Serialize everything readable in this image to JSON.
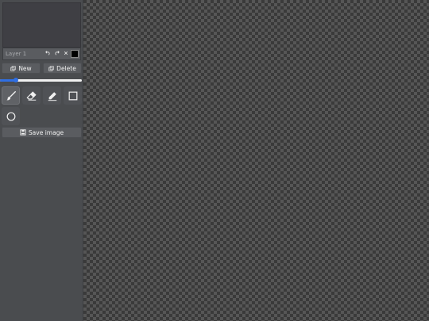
{
  "layer": {
    "name": "Layer 1",
    "swatch_color": "#000000"
  },
  "buttons": {
    "new_label": "New",
    "delete_label": "Delete",
    "save_label": "Save image"
  },
  "brush_size_slider": {
    "fraction": 0.19
  },
  "tools": [
    {
      "name": "brush",
      "icon": "paintbrush-icon",
      "active": true
    },
    {
      "name": "eraser",
      "icon": "eraser-icon",
      "active": false
    },
    {
      "name": "pen",
      "icon": "pen-icon",
      "active": false
    },
    {
      "name": "rectangle",
      "icon": "square-icon",
      "active": false
    },
    {
      "name": "ellipse",
      "icon": "circle-icon",
      "active": false
    }
  ],
  "colors": {
    "accent": "#2f6fe4",
    "sidebar_bg": "#4a4c4f"
  }
}
